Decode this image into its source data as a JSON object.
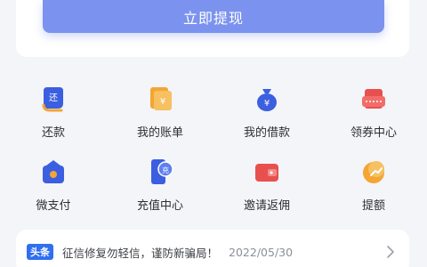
{
  "actions": {
    "withdraw_label": "立即提现"
  },
  "services": [
    {
      "label": "还款",
      "icon": "repay-icon",
      "glyph": "还"
    },
    {
      "label": "我的账单",
      "icon": "bill-icon",
      "glyph": "¥"
    },
    {
      "label": "我的借款",
      "icon": "loan-bag-icon",
      "glyph": "¥"
    },
    {
      "label": "领券中心",
      "icon": "coupon-icon",
      "glyph": ""
    },
    {
      "label": "微支付",
      "icon": "wallet-icon",
      "glyph": "¥"
    },
    {
      "label": "充值中心",
      "icon": "recharge-phone-icon",
      "glyph": "充"
    },
    {
      "label": "邀请返佣",
      "icon": "invite-wallet-icon",
      "glyph": ""
    },
    {
      "label": "提额",
      "icon": "raise-limit-icon",
      "glyph": ""
    }
  ],
  "news": {
    "tag": "头条",
    "text": "征信修复勿轻信，谨防新骗局！",
    "date": "2022/05/30"
  },
  "colors": {
    "primary_button": "#7b93ee",
    "icon_blue": "#3b5fe0",
    "icon_orange": "#f4a532",
    "icon_red": "#e8504e",
    "news_tag": "#2f6ff0"
  }
}
